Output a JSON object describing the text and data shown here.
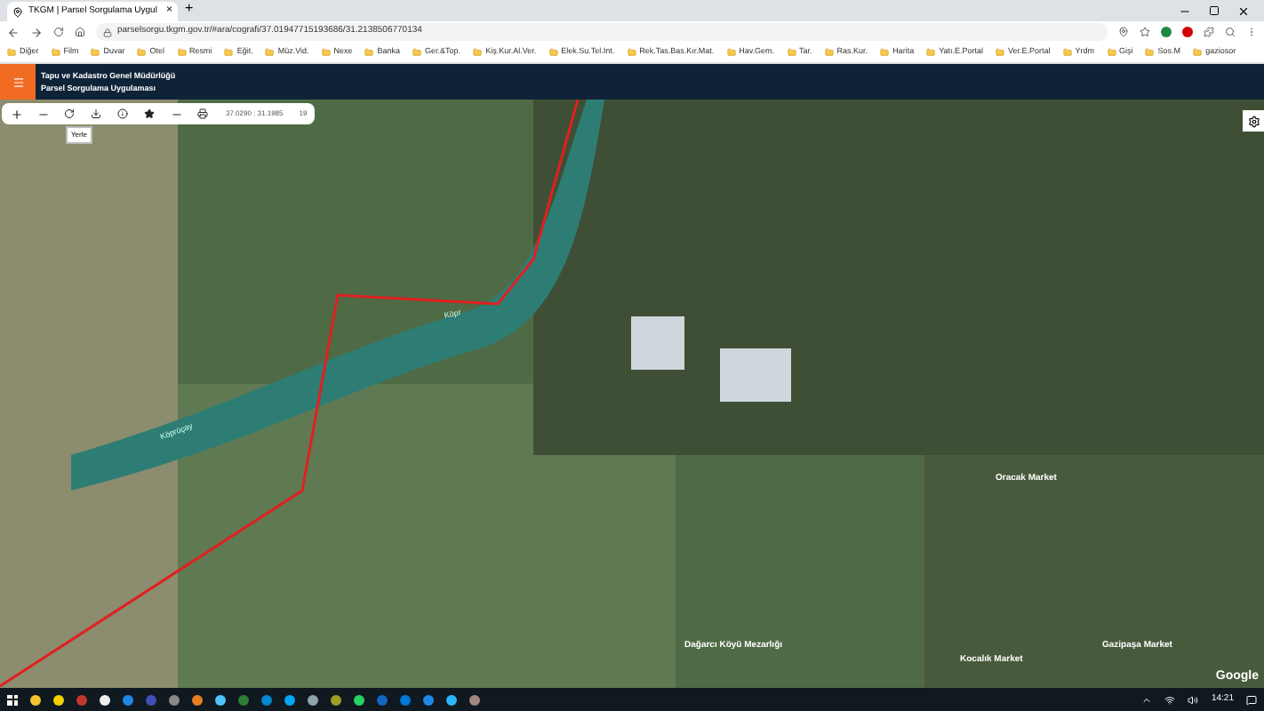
{
  "browser": {
    "tab": {
      "title": "TKGM | Parsel Sorgulama Uygul",
      "close": "×"
    },
    "new_tab": "+",
    "url": "parselsorgu.tkgm.gov.tr/#ara/cografi/37.01947715193686/31.2138506770134",
    "bookmarks": [
      "Diğer",
      "Film",
      "Duvar",
      "Otel",
      "Resmi",
      "Eğit.",
      "Müz.Vid.",
      "Nexe",
      "Banka",
      "Ger.&Top.",
      "Kiş.Kur.Al.Ver.",
      "Elek.Su.Tel.Int.",
      "Rek.Tas.Bas.Kır.Mat.",
      "Hav.Gem.",
      "Tar.",
      "Ras.Kur.",
      "Harita",
      "Yatı.E.Portal",
      "Ver.E.Portal",
      "Yrdm",
      "Gişi",
      "Sos.M",
      "gaziosor"
    ]
  },
  "app": {
    "title": "Tapu ve Kadastro Genel Müdürlüğü",
    "subtitle": "Parsel Sorgulama Uygulaması"
  },
  "toolbar": {
    "coordinates": "37.0290 : 31.1985",
    "zoom": "19",
    "tooltip": "Yerle"
  },
  "map": {
    "labels": [
      {
        "text": "Köprüçay",
        "kind": "river"
      },
      {
        "text": "Köpr",
        "kind": "river"
      },
      {
        "text": "Dağarcı Köyü Mezarlığı",
        "kind": "place"
      },
      {
        "text": "Oracak Market",
        "kind": "place"
      },
      {
        "text": "Kocalık Market",
        "kind": "place"
      },
      {
        "text": "Gazipaşa Market",
        "kind": "place"
      }
    ],
    "attribution": "Google"
  },
  "taskbar": {
    "time": "14:21"
  }
}
